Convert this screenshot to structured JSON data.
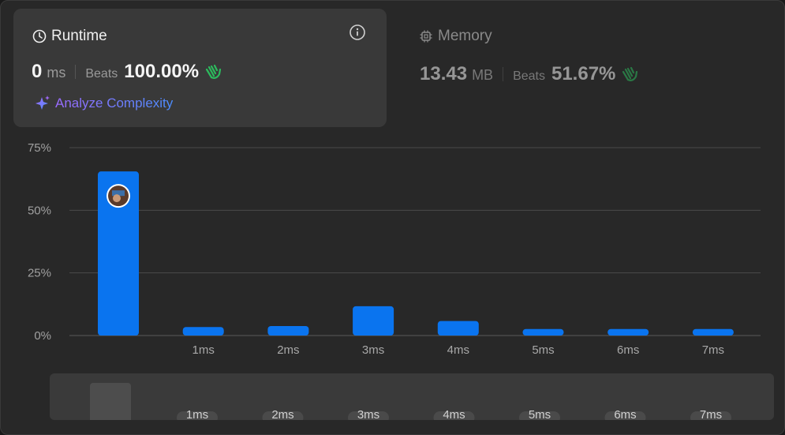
{
  "runtime": {
    "title": "Runtime",
    "value": "0",
    "unit": "ms",
    "beats_label": "Beats",
    "beats_value": "100.00%"
  },
  "memory": {
    "title": "Memory",
    "value": "13.43",
    "unit": "MB",
    "beats_label": "Beats",
    "beats_value": "51.67%"
  },
  "analyze_label": "Analyze Complexity",
  "colors": {
    "accent_bar": "#0a74ef",
    "clap_green": "#2cbb5d",
    "brush_handle": "#4d4d4d"
  },
  "chart_data": {
    "type": "bar",
    "categories": [
      "0ms",
      "1ms",
      "2ms",
      "3ms",
      "4ms",
      "5ms",
      "6ms",
      "7ms"
    ],
    "tick_labels": [
      "",
      "1ms",
      "2ms",
      "3ms",
      "4ms",
      "5ms",
      "6ms",
      "7ms"
    ],
    "values": [
      65.5,
      3.4,
      3.8,
      11.7,
      5.8,
      2.6,
      2.6,
      2.6
    ],
    "y_ticks": [
      "0%",
      "25%",
      "50%",
      "75%"
    ],
    "y_tick_values": [
      0,
      25,
      50,
      75
    ],
    "ylim": [
      0,
      75
    ],
    "grid": true,
    "highlight_category": "0ms",
    "brush": {
      "tick_labels": [
        "1ms",
        "2ms",
        "3ms",
        "4ms",
        "5ms",
        "6ms",
        "7ms"
      ]
    }
  }
}
